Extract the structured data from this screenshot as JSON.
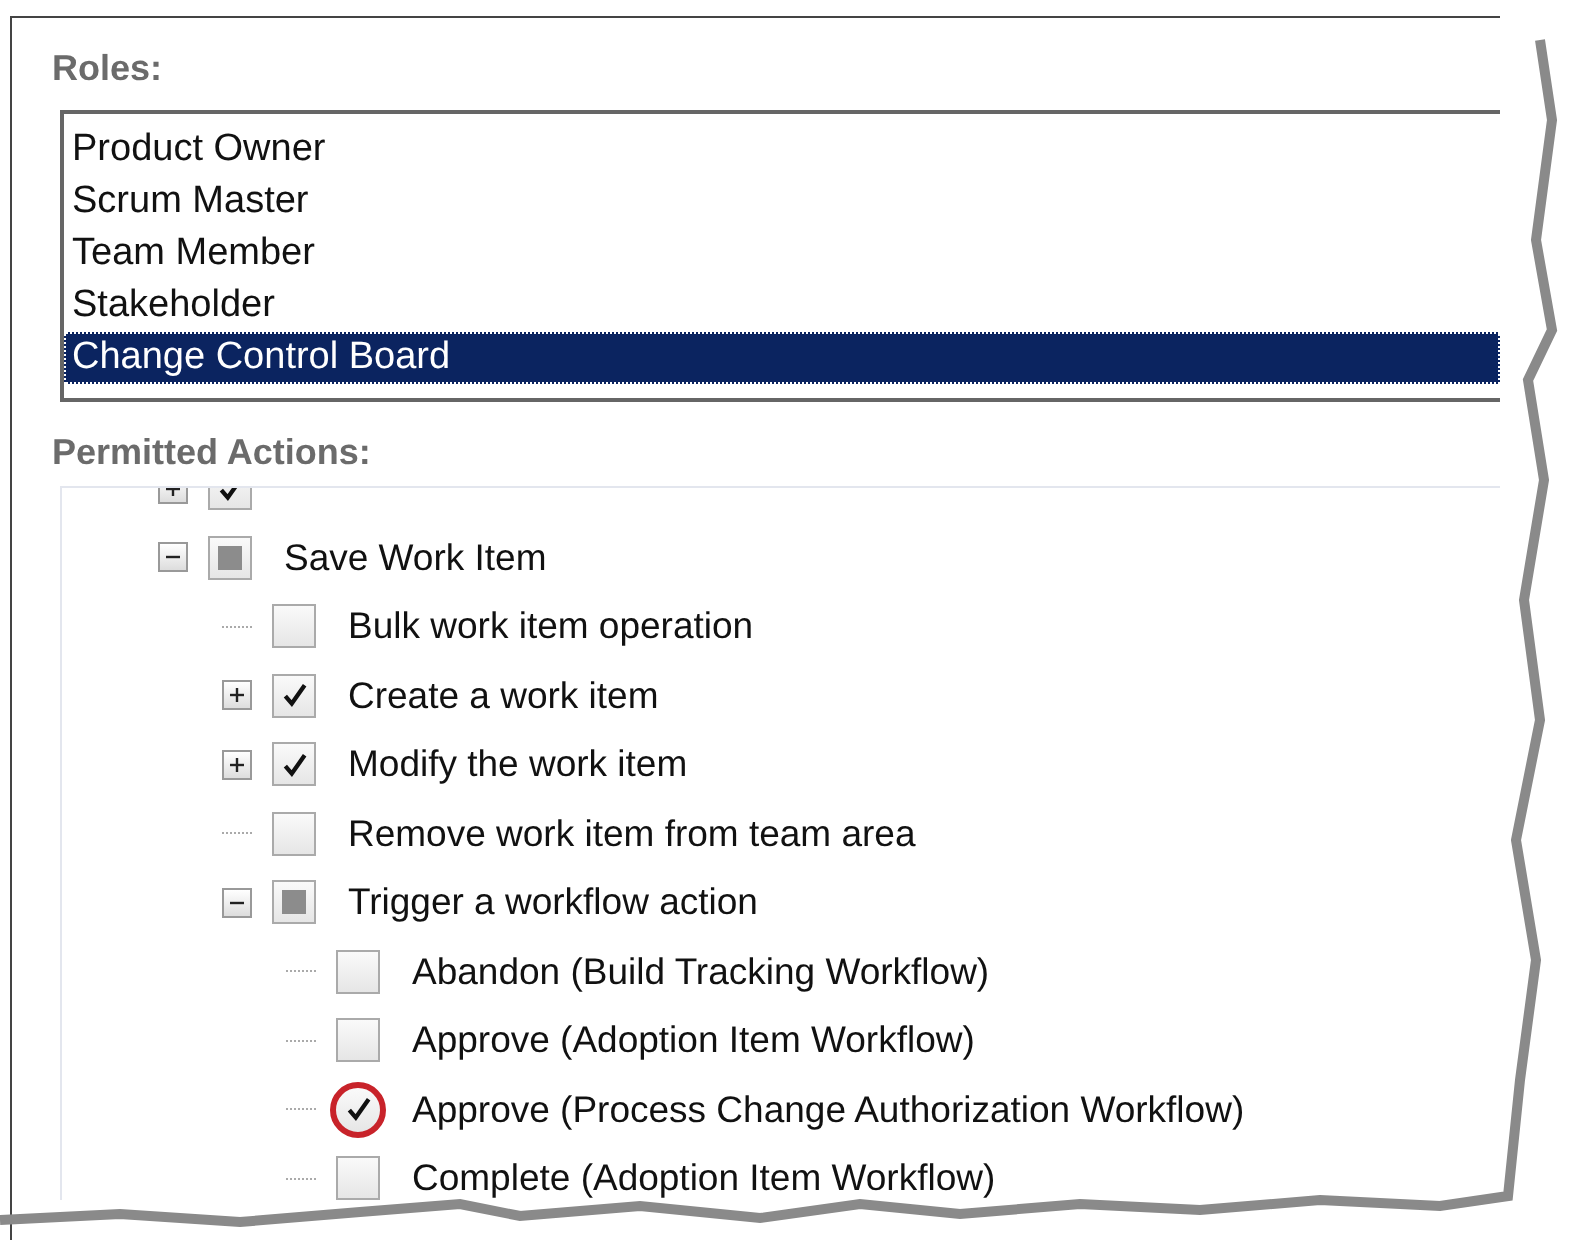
{
  "roles": {
    "label": "Roles:",
    "items": [
      {
        "label": "Product Owner",
        "selected": false
      },
      {
        "label": "Scrum Master",
        "selected": false
      },
      {
        "label": "Team Member",
        "selected": false
      },
      {
        "label": "Stakeholder",
        "selected": false
      },
      {
        "label": "Change Control Board",
        "selected": true
      }
    ]
  },
  "permitted_actions": {
    "label": "Permitted Actions:",
    "items": [
      {
        "checked": true,
        "expanded": false
      },
      {
        "label": "Save Work Item",
        "checked": false,
        "partial": true,
        "expanded": true,
        "children": [
          {
            "label": "Bulk work item operation",
            "checked": false
          },
          {
            "label": "Create a work item",
            "checked": true,
            "expanded": false
          },
          {
            "label": "Modify the work item",
            "checked": true,
            "expanded": false
          },
          {
            "label": "Remove work item from team area",
            "checked": false
          },
          {
            "label": "Trigger a workflow action",
            "checked": false,
            "partial": true,
            "expanded": true,
            "children": [
              {
                "label": "Abandon (Build Tracking Workflow)",
                "checked": false
              },
              {
                "label": "Approve (Adoption Item Workflow)",
                "checked": false
              },
              {
                "label": "Approve (Process Change Authorization Workflow)",
                "checked": true,
                "highlighted": true
              },
              {
                "label": "Complete (Adoption Item Workflow)",
                "checked": false
              }
            ]
          }
        ]
      }
    ]
  }
}
